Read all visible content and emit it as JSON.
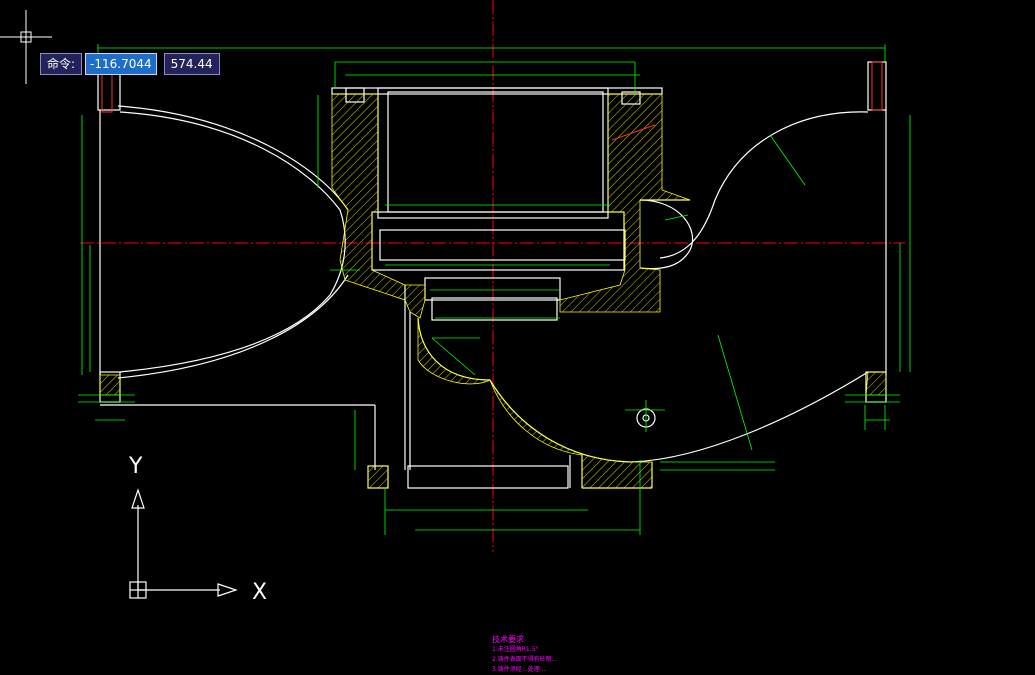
{
  "command_tooltip": {
    "label": "命令:",
    "x_value": "-116.7044",
    "y_value": "574.44"
  },
  "ucs_icon": {
    "x_label": "X",
    "y_label": "Y"
  },
  "tech_notes": {
    "title": "技术要求",
    "lines": [
      "1.未注圆角R1.5°",
      "2.铸件表面不得有砂眼…",
      "3.铸件须经…处理…"
    ]
  },
  "colors": {
    "background": "#000000",
    "geometry": "#ffffff",
    "dimension": "#00ff00",
    "centerline": "#ff0000",
    "hatch": "#ffff00",
    "notes": "#ff00ff",
    "crosshair": "#ffffff"
  }
}
